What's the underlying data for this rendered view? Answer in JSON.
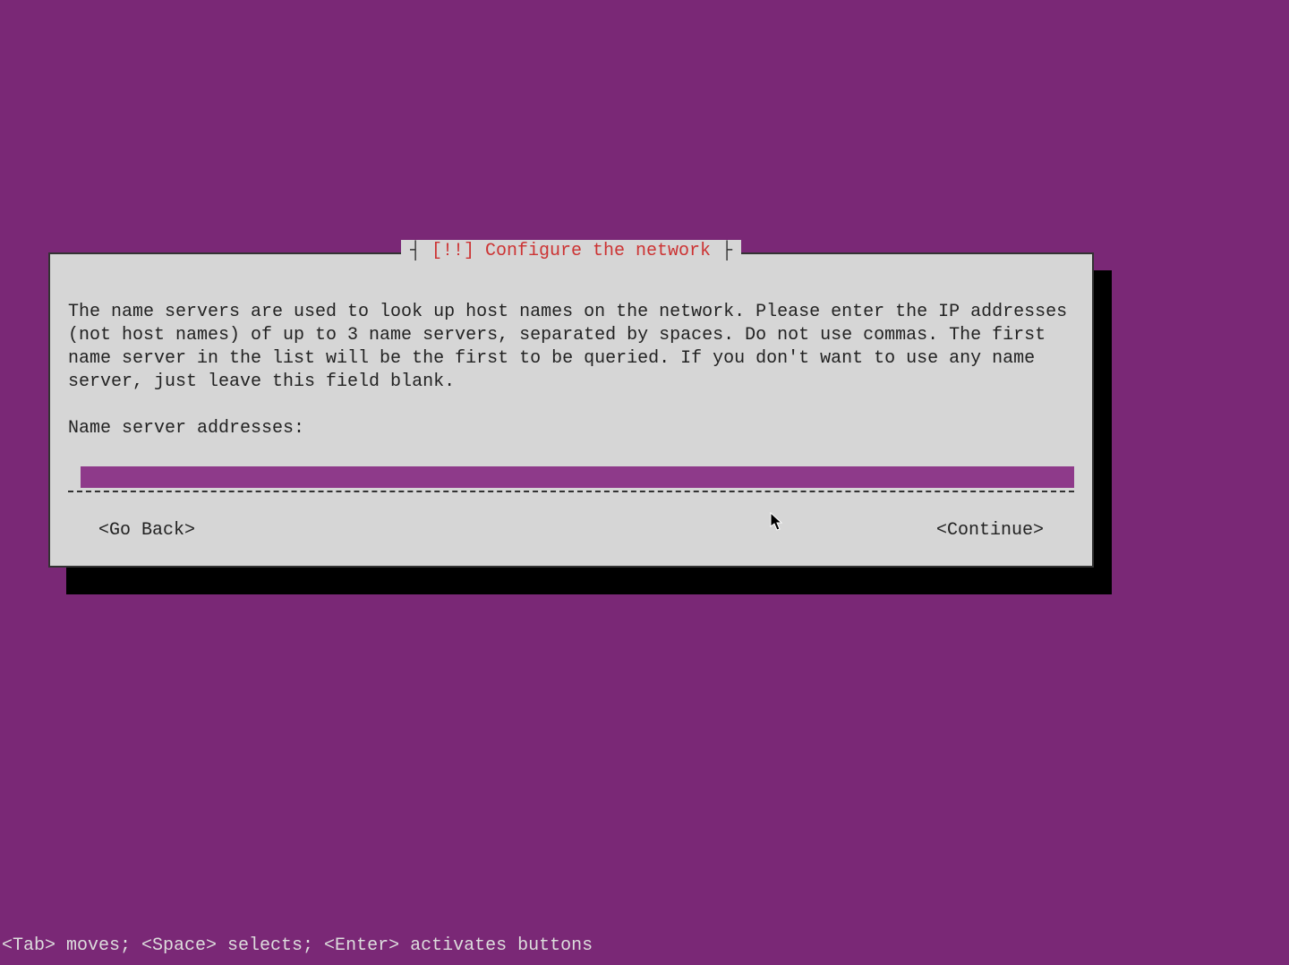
{
  "dialog": {
    "title_prefix": " [!!] ",
    "title": "Configure the network",
    "description": "The name servers are used to look up host names on the network. Please enter the IP addresses (not host names) of up to 3 name servers, separated by spaces. Do not use commas. The first name server in the list will be the first to be queried. If you don't want to use any name server, just leave this field blank.",
    "field_label": "Name server addresses:",
    "input_value": "",
    "buttons": {
      "go_back": "<Go Back>",
      "continue": "<Continue>"
    }
  },
  "footer_hint": "<Tab> moves; <Space> selects; <Enter> activates buttons",
  "colors": {
    "background": "#7a2876",
    "dialog_bg": "#d6d6d6",
    "title_fg": "#cc3333",
    "input_bg": "#8e3a8a"
  }
}
